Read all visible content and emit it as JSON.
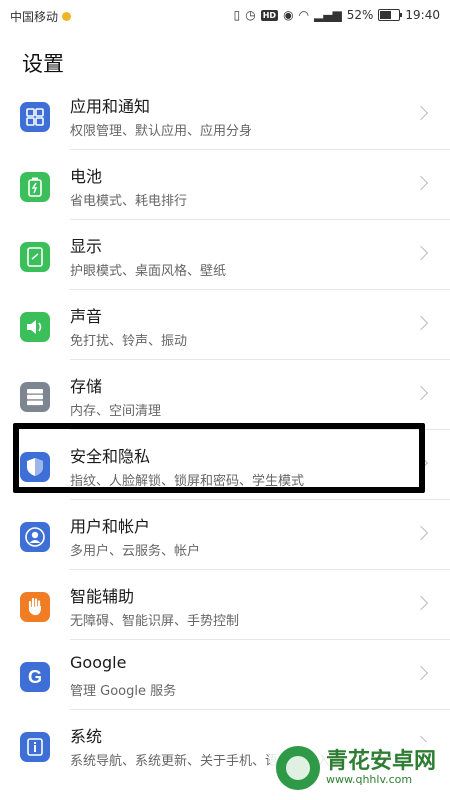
{
  "status_bar": {
    "carrier": "中国移动",
    "battery_percent": "52%",
    "time": "19:40"
  },
  "header": {
    "title": "设置"
  },
  "settings": [
    {
      "label": "应用和通知",
      "desc": "权限管理、默认应用、应用分身",
      "icon": "apps-grid-icon",
      "color": "#3d6fd6"
    },
    {
      "label": "电池",
      "desc": "省电模式、耗电排行",
      "icon": "battery-icon",
      "color": "#3bbf5a"
    },
    {
      "label": "显示",
      "desc": "护眼模式、桌面风格、壁纸",
      "icon": "display-icon",
      "color": "#3bbf5a"
    },
    {
      "label": "声音",
      "desc": "免打扰、铃声、振动",
      "icon": "speaker-icon",
      "color": "#3bbf5a"
    },
    {
      "label": "存储",
      "desc": "内存、空间清理",
      "icon": "storage-icon",
      "color": "#7d8591"
    },
    {
      "label": "安全和隐私",
      "desc": "指纹、人脸解锁、锁屏和密码、学生模式",
      "icon": "shield-icon",
      "color": "#3d6fd6"
    },
    {
      "label": "用户和帐户",
      "desc": "多用户、云服务、帐户",
      "icon": "user-icon",
      "color": "#3d6fd6"
    },
    {
      "label": "智能辅助",
      "desc": "无障碍、智能识屏、手势控制",
      "icon": "hand-icon",
      "color": "#f07d23"
    },
    {
      "label": "Google",
      "desc": "管理 Google 服务",
      "icon": "google-icon",
      "color": "#3d6fd6"
    },
    {
      "label": "系统",
      "desc": "系统导航、系统更新、关于手机、语言和输入法",
      "icon": "info-icon",
      "color": "#3d6fd6"
    }
  ],
  "watermark": {
    "name": "青花安卓网",
    "url": "www.qhhlv.com"
  }
}
